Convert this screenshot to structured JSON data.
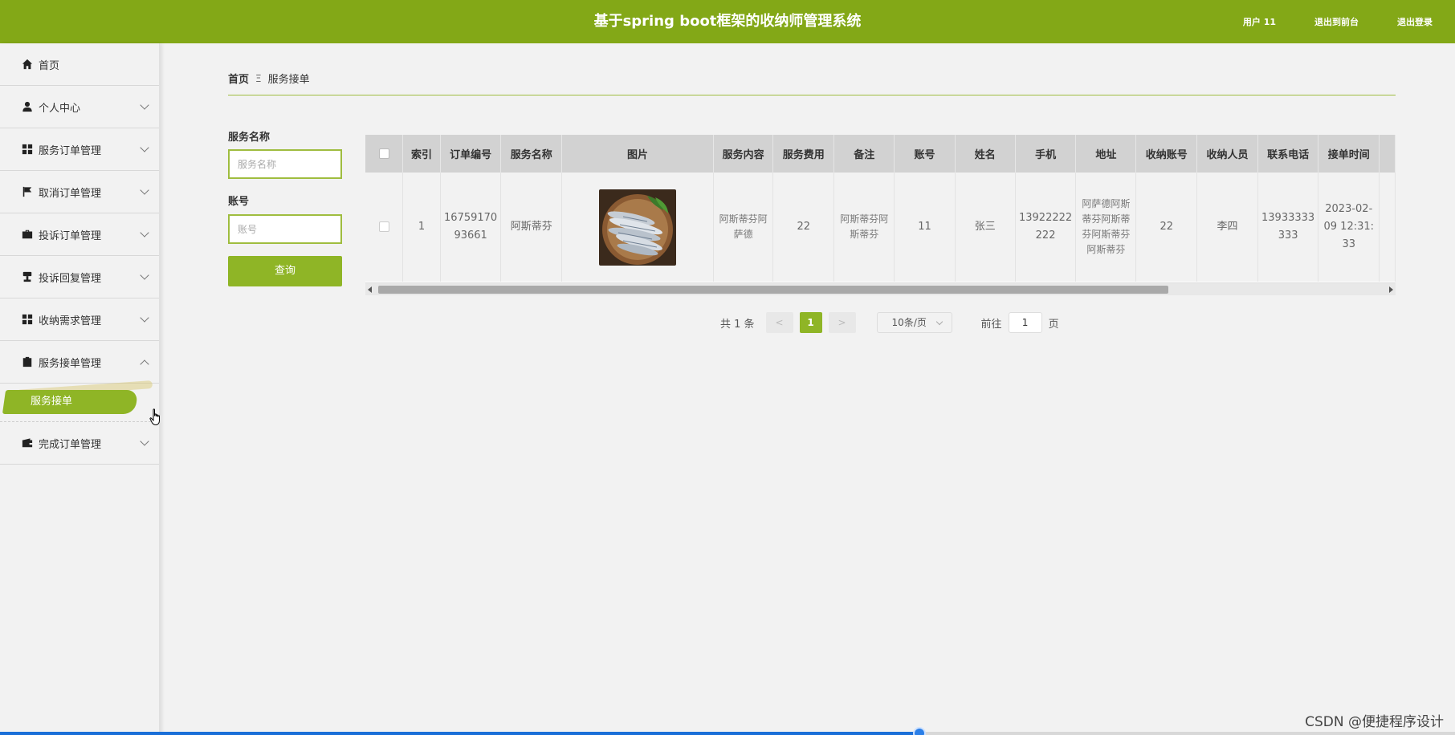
{
  "header": {
    "title": "基于spring boot框架的收纳师管理系统",
    "user": "用户 11",
    "back_to_admin": "退出到前台",
    "logout": "退出登录"
  },
  "sidebar": {
    "items": [
      {
        "label": "首页",
        "icon": "home-icon"
      },
      {
        "label": "个人中心",
        "icon": "user-icon"
      },
      {
        "label": "服务订单管理",
        "icon": "grid-icon"
      },
      {
        "label": "取消订单管理",
        "icon": "flag-icon"
      },
      {
        "label": "投诉订单管理",
        "icon": "briefcase-icon"
      },
      {
        "label": "投诉回复管理",
        "icon": "stamp-icon"
      },
      {
        "label": "收纳需求管理",
        "icon": "grid-icon"
      },
      {
        "label": "服务接单管理",
        "icon": "clipboard-icon"
      },
      {
        "label": "完成订单管理",
        "icon": "wallet-icon"
      }
    ],
    "active_sub": "服务接单"
  },
  "breadcrumb": {
    "home": "首页",
    "sep": "Ξ",
    "current": "服务接单"
  },
  "search": {
    "service_name_label": "服务名称",
    "service_name_placeholder": "服务名称",
    "account_label": "账号",
    "account_placeholder": "账号",
    "query_button": "查询"
  },
  "table": {
    "columns": [
      "索引",
      "订单编号",
      "服务名称",
      "图片",
      "服务内容",
      "服务费用",
      "备注",
      "账号",
      "姓名",
      "手机",
      "地址",
      "收纳账号",
      "收纳人员",
      "联系电话",
      "接单时间"
    ],
    "rows": [
      {
        "index": "1",
        "order_no": "1675917093661",
        "service_name": "阿斯蒂芬",
        "service_content": "阿斯蒂芬阿萨德",
        "fee": "22",
        "remark": "阿斯蒂芬阿斯蒂芬",
        "account": "11",
        "name": "张三",
        "phone": "13922222222",
        "address": "阿萨德阿斯蒂芬阿斯蒂芬阿斯蒂芬阿斯蒂芬",
        "storage_account": "22",
        "storage_staff": "李四",
        "contact_phone": "13933333333",
        "accept_time": "2023-02-09 12:31:33"
      }
    ]
  },
  "pager": {
    "total": "共 1 条",
    "prev": "<",
    "page": "1",
    "next": ">",
    "page_size": "10条/页",
    "goto_label": "前往",
    "goto_value": "1",
    "goto_suffix": "页"
  },
  "watermark": "CSDN @便捷程序设计",
  "colors": {
    "accent": "#83a817",
    "button": "#8fb526"
  }
}
